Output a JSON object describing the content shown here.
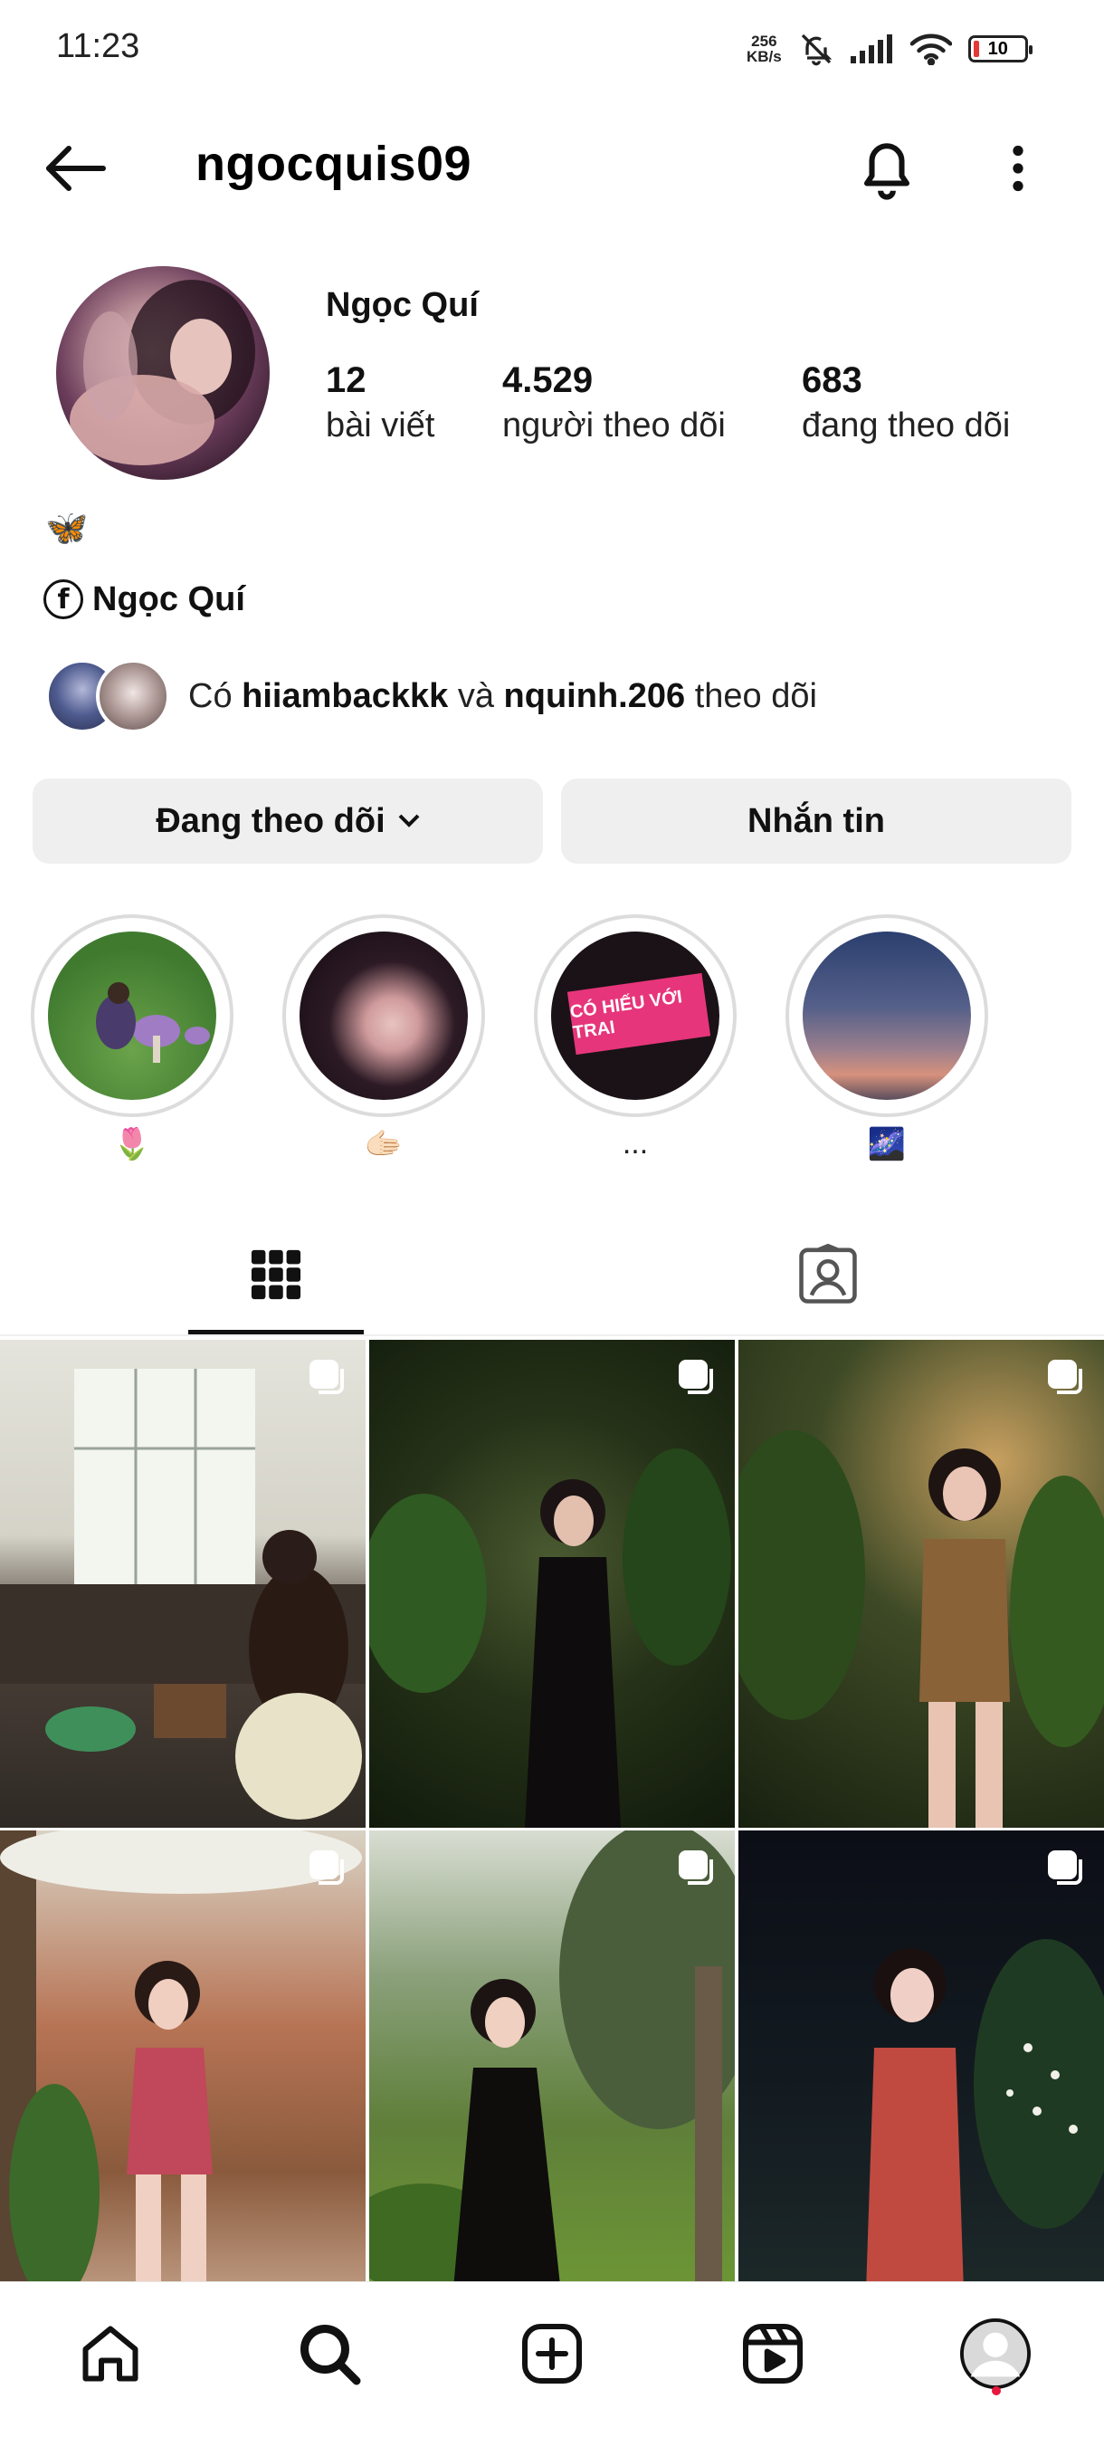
{
  "status_bar": {
    "time": "11:23",
    "net_speed_value": "256",
    "net_speed_unit": "KB/s",
    "battery_level": "10"
  },
  "header": {
    "username": "ngocquis09",
    "back_icon": "arrow-left-icon",
    "bell_icon": "bell-icon",
    "more_icon": "more-vertical-icon"
  },
  "profile": {
    "display_name": "Ngọc Quí",
    "stats": [
      {
        "value": "12",
        "label": "bài viết"
      },
      {
        "value": "4.529",
        "label": "người theo dõi"
      },
      {
        "value": "683",
        "label": "đang theo dõi"
      }
    ],
    "bio_emoji": "🦋",
    "facebook_name": "Ngọc Quí",
    "followed_by": {
      "prefix": "Có",
      "user1": "hiiambackkk",
      "conj": "và",
      "user2": "nquinh.206",
      "suffix": "theo dõi"
    }
  },
  "buttons": {
    "following": "Đang theo dõi",
    "message": "Nhắn tin"
  },
  "highlights": [
    {
      "label": "🌷"
    },
    {
      "label": "🫱🏻"
    },
    {
      "label": "..."
    },
    {
      "label": "🌌"
    }
  ],
  "highlight_3_text": "CÓ HIẾU VỚI TRAI",
  "tabs": [
    {
      "name": "posts-grid",
      "icon": "grid-icon",
      "active": true
    },
    {
      "name": "tagged",
      "icon": "tagged-person-icon",
      "active": false
    }
  ],
  "nav": [
    {
      "icon": "home-icon"
    },
    {
      "icon": "search-icon"
    },
    {
      "icon": "create-plus-icon"
    },
    {
      "icon": "reels-icon"
    },
    {
      "icon": "profile-avatar-icon"
    }
  ],
  "colors": {
    "button_bg": "#efefef",
    "notification_dot": "#e8173c",
    "battery_low": "#e53935"
  }
}
